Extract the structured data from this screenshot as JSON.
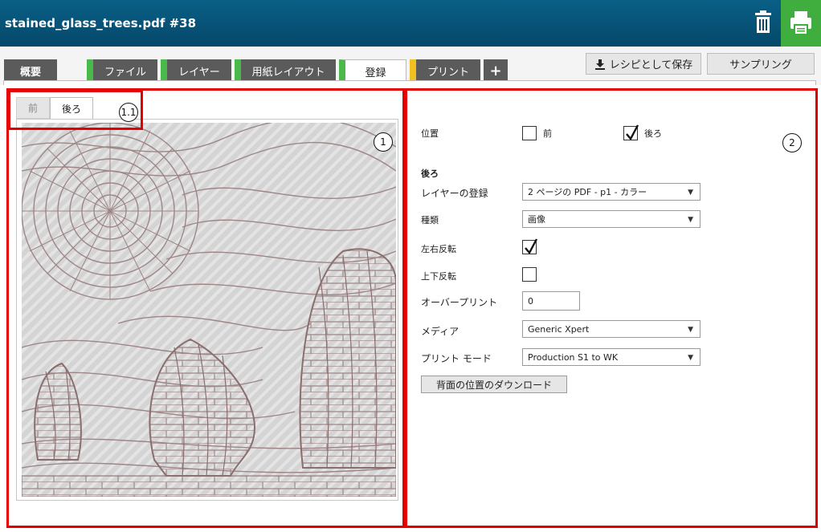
{
  "header": {
    "title": "stained_glass_trees.pdf #38",
    "trash_icon": "trash-icon",
    "print_icon": "printer-icon",
    "print_bg": "#3fae3f"
  },
  "tabs": [
    {
      "label": "概要",
      "state": "overview"
    },
    {
      "label": "ファイル",
      "status_color": "#4bb84b"
    },
    {
      "label": "レイヤー",
      "status_color": "#4bb84b"
    },
    {
      "label": "用紙レイアウト",
      "status_color": "#4bb84b"
    },
    {
      "label": "登録",
      "status_color": "#4bb84b",
      "active": true
    },
    {
      "label": "プリント",
      "status_color": "#f0c020"
    },
    {
      "label": "+",
      "icon": "plus-icon"
    }
  ],
  "toolbar": {
    "save_recipe_label": "レシピとして保存",
    "save_icon": "download-icon",
    "sampling_label": "サンプリング"
  },
  "annotations": {
    "preview_marker": "1",
    "side_tabs_marker": "1.1",
    "settings_marker": "2",
    "color": "#e40000"
  },
  "preview": {
    "tab_front": "前",
    "tab_back": "後ろ",
    "active_tab": "後ろ"
  },
  "form": {
    "position_label": "位置",
    "position_front_label": "前",
    "position_front_checked": false,
    "position_back_label": "後ろ",
    "position_back_checked": true,
    "section_title": "後ろ",
    "layer_registration_label": "レイヤーの登録",
    "layer_registration_value": "2 ページの PDF - p1 - カラー",
    "type_label": "種類",
    "type_value": "画像",
    "flip_horizontal_label": "左右反転",
    "flip_horizontal_checked": true,
    "flip_vertical_label": "上下反転",
    "flip_vertical_checked": false,
    "overprint_label": "オーバープリント",
    "overprint_value": "0",
    "media_label": "メディア",
    "media_value": "Generic Xpert",
    "print_mode_label": "プリント モード",
    "print_mode_value": "Production S1 to WK",
    "download_button_label": "背面の位置のダウンロード"
  }
}
